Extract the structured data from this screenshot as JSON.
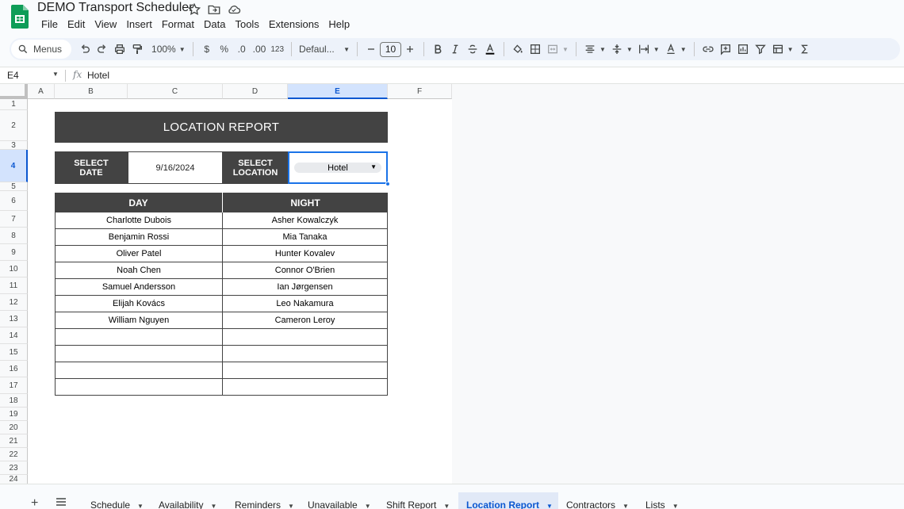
{
  "document": {
    "title": "DEMO Transport Scheduler",
    "menus": [
      "File",
      "Edit",
      "View",
      "Insert",
      "Format",
      "Data",
      "Tools",
      "Extensions",
      "Help"
    ]
  },
  "toolbar": {
    "search_label": "Menus",
    "zoom": "100%",
    "currency": "$",
    "percent": "%",
    "decrease_decimal": ".0",
    "increase_decimal": ".00",
    "number_format": "123",
    "font": "Defaul...",
    "font_size": "10"
  },
  "formula_bar": {
    "cell_ref": "E4",
    "fx": "fx",
    "value": "Hotel"
  },
  "grid": {
    "columns": [
      "A",
      "B",
      "C",
      "D",
      "E",
      "F"
    ],
    "rows": [
      "1",
      "2",
      "3",
      "4",
      "5",
      "6",
      "7",
      "8",
      "9",
      "10",
      "11",
      "12",
      "13",
      "14",
      "15",
      "16",
      "17",
      "18",
      "19",
      "20",
      "21",
      "22",
      "23",
      "24"
    ],
    "report_title": "LOCATION REPORT",
    "select_date_label": "SELECT\nDATE",
    "select_date_value": "9/16/2024",
    "select_location_label": "SELECT\nLOCATION",
    "select_location_value": "Hotel",
    "day_header": "DAY",
    "night_header": "NIGHT",
    "day_names": [
      "Charlotte Dubois",
      "Benjamin Rossi",
      "Oliver Patel",
      "Noah Chen",
      "Samuel Andersson",
      "Elijah Kovács",
      "William Nguyen",
      "",
      "",
      "",
      ""
    ],
    "night_names": [
      "Asher Kowalczyk",
      "Mia Tanaka",
      "Hunter Kovalev",
      "Connor O'Brien",
      "Ian Jørgensen",
      "Leo Nakamura",
      "Cameron Leroy",
      "",
      "",
      "",
      ""
    ]
  },
  "sheet_tabs": {
    "tabs": [
      "Schedule",
      "Availability",
      "Reminders",
      "Unavailable",
      "Shift Report",
      "Location Report",
      "Contractors",
      "Lists"
    ],
    "active": "Location Report"
  },
  "colors": {
    "header_dark": "#434343",
    "selection_blue": "#1a73e8",
    "active_tab": "#0b57d0",
    "sheets_green": "#0f9d58"
  }
}
